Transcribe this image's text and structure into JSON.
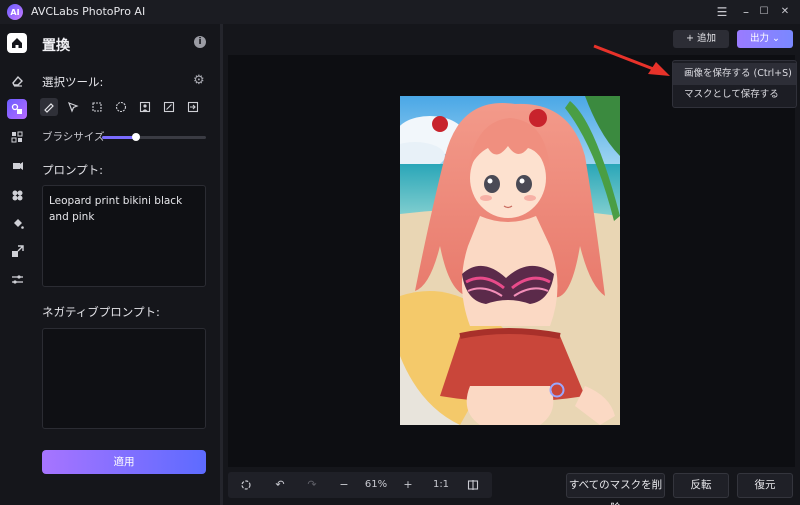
{
  "app": {
    "title": "AVCLabs PhotoPro AI",
    "logo_text": "AI"
  },
  "window_controls": {
    "menu": "☰",
    "minimize": "–",
    "maximize": "☐",
    "close": "✕"
  },
  "rail": {
    "items": [
      {
        "name": "home",
        "glyph": "⌂"
      },
      {
        "name": "eraser",
        "glyph": "⌫"
      },
      {
        "name": "replace",
        "glyph": "◈"
      },
      {
        "name": "enhance",
        "glyph": "⛶"
      },
      {
        "name": "colorize",
        "glyph": "✎"
      },
      {
        "name": "background",
        "glyph": "✣"
      },
      {
        "name": "fill",
        "glyph": "◆"
      },
      {
        "name": "upscale",
        "glyph": "⤢"
      },
      {
        "name": "adjust",
        "glyph": "≡"
      }
    ]
  },
  "panel": {
    "title": "置換",
    "tool_section": "選択ツール:",
    "brush_size_label": "ブラシサイズ",
    "brush_size_value": 0.33,
    "prompt_label": "プロンプト:",
    "prompt_text": "Leopard print bikini black and pink",
    "negative_prompt_label": "ネガティブプロンプト:",
    "negative_prompt_text": "",
    "apply_label": "適用",
    "tools": [
      "brush",
      "pointer",
      "rect-select",
      "ellipse-select",
      "person-select",
      "ai-select",
      "import"
    ]
  },
  "header": {
    "add_label": "+ 追加",
    "output_label": "出力 ⌄"
  },
  "dropdown": {
    "items": [
      "画像を保存する (Ctrl+S)",
      "マスクとして保存する"
    ]
  },
  "bottom": {
    "zoom": "61%",
    "ratio": "1:1",
    "clear_masks_label": "すべてのマスクを削除",
    "invert_label": "反転",
    "restore_label": "復元"
  },
  "colors": {
    "accent": "#7b6cff",
    "annotation_arrow": "#e8322a"
  }
}
